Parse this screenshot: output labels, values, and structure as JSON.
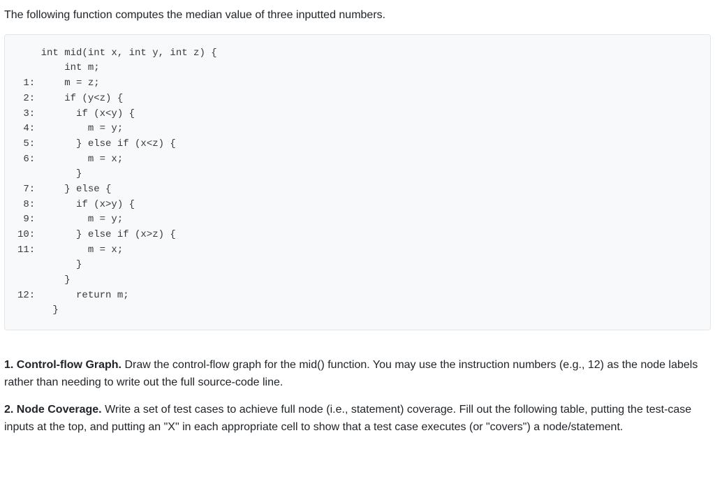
{
  "intro": "The following function computes the median value of three inputted numbers.",
  "code": {
    "lines": [
      {
        "label": "",
        "text": "int mid(int x, int y, int z) {"
      },
      {
        "label": "",
        "text": "    int m;"
      },
      {
        "label": "1:",
        "text": "    m = z;"
      },
      {
        "label": "2:",
        "text": "    if (y<z) {"
      },
      {
        "label": "3:",
        "text": "      if (x<y) {"
      },
      {
        "label": "4:",
        "text": "        m = y;"
      },
      {
        "label": "5:",
        "text": "      } else if (x<z) {"
      },
      {
        "label": "6:",
        "text": "        m = x;"
      },
      {
        "label": "",
        "text": "      }"
      },
      {
        "label": "7:",
        "text": "    } else {"
      },
      {
        "label": "8:",
        "text": "      if (x>y) {"
      },
      {
        "label": "9:",
        "text": "        m = y;"
      },
      {
        "label": "10:",
        "text": "      } else if (x>z) {"
      },
      {
        "label": "11:",
        "text": "        m = x;"
      },
      {
        "label": "",
        "text": "      }"
      },
      {
        "label": "",
        "text": "    }"
      },
      {
        "label": "12:",
        "text": "      return m;"
      },
      {
        "label": "",
        "text": "  }"
      }
    ]
  },
  "questions": {
    "q1": {
      "number": "1.",
      "title": "Control-flow Graph.",
      "body": "Draw the control-flow graph for the mid() function. You may use the instruction numbers (e.g., 12) as the node labels rather than needing to write out the full source-code line."
    },
    "q2": {
      "number": "2.",
      "title": "Node Coverage.",
      "body": "Write a set of test cases to achieve full node (i.e., statement) coverage. Fill out the following table, putting the test-case inputs at the top, and putting an \"X\" in each appropriate cell to show that a test case executes (or \"covers\") a node/statement."
    }
  }
}
